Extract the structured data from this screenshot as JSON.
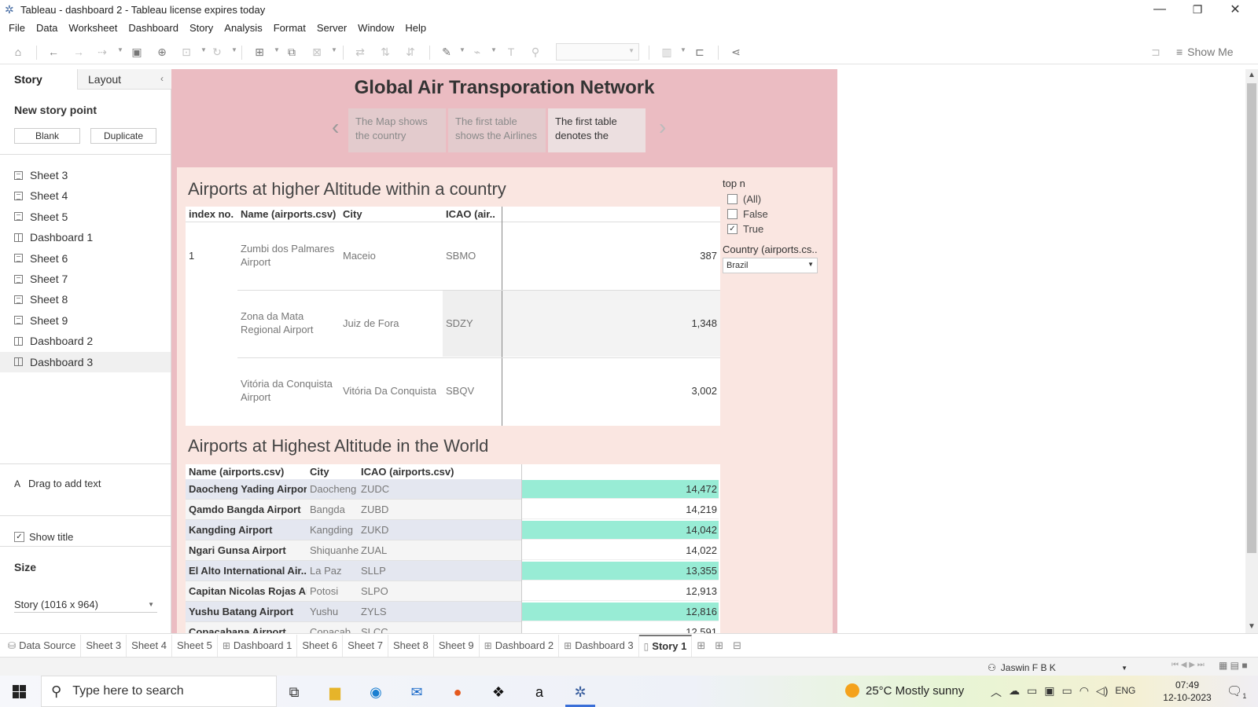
{
  "window": {
    "title": "Tableau - dashboard 2 - Tableau license expires today",
    "minimize_glyph": "—",
    "maximize_glyph": "❐",
    "close_glyph": "✕"
  },
  "menu": [
    "File",
    "Data",
    "Worksheet",
    "Dashboard",
    "Story",
    "Analysis",
    "Format",
    "Server",
    "Window",
    "Help"
  ],
  "toolbar": {
    "show_me": "Show Me"
  },
  "side_panel": {
    "tab_story": "Story",
    "tab_layout": "Layout",
    "new_story_point": "New story point",
    "blank_button": "Blank",
    "duplicate_button": "Duplicate",
    "sheets": [
      {
        "label": "Sheet 3",
        "kind": "sheet"
      },
      {
        "label": "Sheet 4",
        "kind": "sheet"
      },
      {
        "label": "Sheet 5",
        "kind": "sheet"
      },
      {
        "label": "Dashboard 1",
        "kind": "dashboard"
      },
      {
        "label": "Sheet 6",
        "kind": "sheet"
      },
      {
        "label": "Sheet 7",
        "kind": "sheet"
      },
      {
        "label": "Sheet 8",
        "kind": "sheet"
      },
      {
        "label": "Sheet 9",
        "kind": "sheet"
      },
      {
        "label": "Dashboard 2",
        "kind": "dashboard"
      },
      {
        "label": "Dashboard 3",
        "kind": "dashboard"
      }
    ],
    "drag_text": "Drag to add text",
    "show_title": "Show title",
    "show_title_checked": true,
    "size_heading": "Size",
    "size_value": "Story (1016 x 964)"
  },
  "story": {
    "title": "Global Air Transporation Network",
    "points": [
      {
        "text": "The Map shows the country",
        "selected": false
      },
      {
        "text": "The first table shows the Airlines",
        "selected": false
      },
      {
        "text": "The first table denotes the",
        "selected": true
      }
    ]
  },
  "table1": {
    "title": "Airports at higher Altitude within a country",
    "headers": [
      "index no.",
      "Name (airports.csv)",
      "City",
      "ICAO (air.."
    ],
    "rows": [
      {
        "index": "1",
        "name": "Zumbi dos Palmares Airport",
        "city": "Maceio",
        "icao": "SBMO",
        "value": "387"
      },
      {
        "index": "",
        "name": "Zona da Mata Regional Airport",
        "city": "Juiz de Fora",
        "icao": "SDZY",
        "value": "1,348"
      },
      {
        "index": "",
        "name": "Vitória da Conquista Airport",
        "city": "Vitória Da Conquista",
        "icao": "SBQV",
        "value": "3,002"
      }
    ]
  },
  "filters": {
    "top_n_title": "top n",
    "options": [
      {
        "label": "(All)",
        "checked": false
      },
      {
        "label": "False",
        "checked": false
      },
      {
        "label": "True",
        "checked": true
      }
    ],
    "country_title": "Country (airports.cs..",
    "country_value": "Brazil"
  },
  "table2": {
    "title": "Airports at Highest Altitude in the World",
    "headers": [
      "Name (airports.csv)",
      "City",
      "ICAO (airports.csv)"
    ],
    "highlight_color": "#98ecd5",
    "rows": [
      {
        "name": "Daocheng Yading Airport",
        "city": "Daocheng",
        "icao": "ZUDC",
        "value": "14,472",
        "highlight": true
      },
      {
        "name": "Qamdo Bangda Airport",
        "city": "Bangda",
        "icao": "ZUBD",
        "value": "14,219",
        "highlight": false
      },
      {
        "name": "Kangding Airport",
        "city": "Kangding",
        "icao": "ZUKD",
        "value": "14,042",
        "highlight": true
      },
      {
        "name": "Ngari Gunsa Airport",
        "city": "Shiquanhe",
        "icao": "ZUAL",
        "value": "14,022",
        "highlight": false
      },
      {
        "name": "El Alto International Air..",
        "city": "La Paz",
        "icao": "SLLP",
        "value": "13,355",
        "highlight": true
      },
      {
        "name": "Capitan Nicolas Rojas Ai..",
        "city": "Potosi",
        "icao": "SLPO",
        "value": "12,913",
        "highlight": false
      },
      {
        "name": "Yushu Batang Airport",
        "city": "Yushu",
        "icao": "ZYLS",
        "value": "12,816",
        "highlight": true
      },
      {
        "name": "Copacabana Airport",
        "city": "Copacab..",
        "icao": "SLCC",
        "value": "12,591",
        "highlight": false
      }
    ]
  },
  "sheet_tabs": [
    {
      "label": "Data Source",
      "icon": "database-icon",
      "active": false
    },
    {
      "label": "Sheet 3",
      "icon": "",
      "active": false
    },
    {
      "label": "Sheet 4",
      "icon": "",
      "active": false
    },
    {
      "label": "Sheet 5",
      "icon": "",
      "active": false
    },
    {
      "label": "Dashboard 1",
      "icon": "dashboard-icon",
      "active": false
    },
    {
      "label": "Sheet 6",
      "icon": "",
      "active": false
    },
    {
      "label": "Sheet 7",
      "icon": "",
      "active": false
    },
    {
      "label": "Sheet 8",
      "icon": "",
      "active": false
    },
    {
      "label": "Sheet 9",
      "icon": "",
      "active": false
    },
    {
      "label": "Dashboard 2",
      "icon": "dashboard-icon",
      "active": false
    },
    {
      "label": "Dashboard 3",
      "icon": "dashboard-icon",
      "active": false
    },
    {
      "label": "Story 1",
      "icon": "story-icon",
      "active": true
    }
  ],
  "status": {
    "user": "Jaswin F B K"
  },
  "taskbar": {
    "search_placeholder": "Type here to search",
    "weather": "25°C  Mostly sunny",
    "language": "ENG",
    "time": "07:49",
    "date": "12-10-2023",
    "notifications": "1"
  }
}
